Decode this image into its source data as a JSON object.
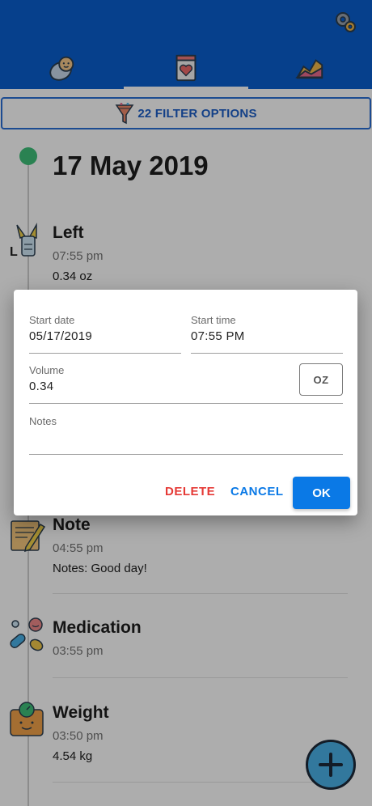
{
  "filter": {
    "label": "22 FILTER OPTIONS"
  },
  "timeline": {
    "date": "17 May 2019",
    "entries": [
      {
        "title": "Left",
        "time": "07:55 pm",
        "detail": "0.34 oz"
      },
      {
        "title": "Note",
        "time": "04:55 pm",
        "detail": "Notes: Good day!"
      },
      {
        "title": "Medication",
        "time": "03:55 pm"
      },
      {
        "title": "Weight",
        "time": "03:50 pm",
        "detail": "4.54 kg"
      }
    ]
  },
  "dialog": {
    "start_date_label": "Start date",
    "start_date_value": "05/17/2019",
    "start_time_label": "Start time",
    "start_time_value": "07:55 PM",
    "volume_label": "Volume",
    "volume_value": "0.34",
    "unit_label": "OZ",
    "notes_label": "Notes",
    "notes_value": "",
    "delete_label": "DELETE",
    "cancel_label": "CANCEL",
    "ok_label": "OK"
  },
  "colors": {
    "appbar": "#0a5fce",
    "accent": "#0a79e6",
    "delete": "#e53935",
    "timeline_dot": "#3fc07a"
  },
  "icons": {
    "settings": "gear-icon",
    "tab_baby": "baby-icon",
    "tab_journal": "journal-heart-icon",
    "tab_stats": "chart-icon",
    "filter": "funnel-icon",
    "entry_left": "breast-pump-icon",
    "entry_note": "note-pencil-icon",
    "entry_medication": "pills-icon",
    "entry_weight": "scale-icon",
    "add": "plus-icon"
  }
}
